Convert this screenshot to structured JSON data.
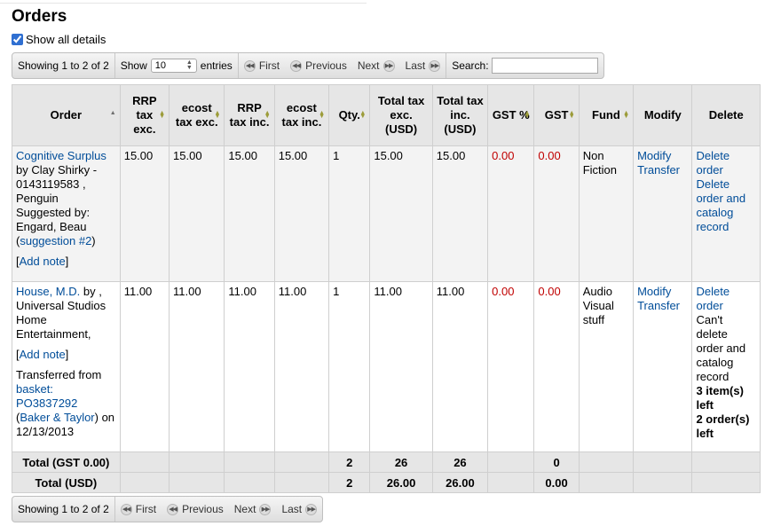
{
  "page": {
    "title": "Orders"
  },
  "show_all": {
    "label": "Show all details",
    "checked": true
  },
  "pager_top": {
    "info": "Showing 1 to 2 of 2",
    "show_label": "Show",
    "length_value": "10",
    "entries_label": "entries",
    "first": "First",
    "previous": "Previous",
    "next": "Next",
    "last": "Last",
    "search_label": "Search:",
    "search_value": ""
  },
  "pager_bottom": {
    "info": "Showing 1 to 2 of 2",
    "first": "First",
    "previous": "Previous",
    "next": "Next",
    "last": "Last"
  },
  "columns": {
    "order": "Order",
    "rrp_exc": "RRP tax exc.",
    "ecost_exc": "ecost tax exc.",
    "rrp_inc": "RRP tax inc.",
    "ecost_inc": "ecost tax inc.",
    "qty": "Qty.",
    "total_exc": "Total tax exc. (USD)",
    "total_inc": "Total tax inc. (USD)",
    "gst_pct": "GST %",
    "gst": "GST",
    "fund": "Fund",
    "modify": "Modify",
    "delete": "Delete"
  },
  "rows": [
    {
      "title": "Cognitive Surplus",
      "by": " by Clay Shirky - 0143119583 , Penguin",
      "suggested_by": "Suggested by: Engard, Beau (",
      "suggestion_link": "suggestion #2",
      "suggested_close": ")",
      "add_note": "Add note",
      "rrp_exc": "15.00",
      "ecost_exc": "15.00",
      "rrp_inc": "15.00",
      "ecost_inc": "15.00",
      "qty": "1",
      "total_exc": "15.00",
      "total_inc": "15.00",
      "gst_pct": "0.00",
      "gst": "0.00",
      "fund": "Non Fiction",
      "modify": "Modify",
      "transfer": "Transfer",
      "delete_order": "Delete order",
      "delete_order_catalog": "Delete order and catalog record"
    },
    {
      "title": "House, M.D.",
      "by": " by , Universal Studios Home Entertainment,",
      "add_note": "Add note",
      "transferred_from": "Transferred from ",
      "basket_link": "basket: PO3837292",
      "vendor_link": "Baker & Taylor",
      "transferred_on": ") on 12/13/2013",
      "rrp_exc": "11.00",
      "ecost_exc": "11.00",
      "rrp_inc": "11.00",
      "ecost_inc": "11.00",
      "qty": "1",
      "total_exc": "11.00",
      "total_inc": "11.00",
      "gst_pct": "0.00",
      "gst": "0.00",
      "fund": "Audio Visual stuff",
      "modify": "Modify",
      "transfer": "Transfer",
      "delete_order": "Delete order",
      "cant_delete": "Can't delete order and catalog record",
      "items_left": "3 item(s) left",
      "orders_left": "2 order(s) left"
    }
  ],
  "footer": [
    {
      "label": "Total (GST 0.00)",
      "qty": "2",
      "total_exc": "26",
      "total_inc": "26",
      "gst": "0"
    },
    {
      "label": "Total (USD)",
      "qty": "2",
      "total_exc": "26.00",
      "total_inc": "26.00",
      "gst": "0.00"
    }
  ]
}
